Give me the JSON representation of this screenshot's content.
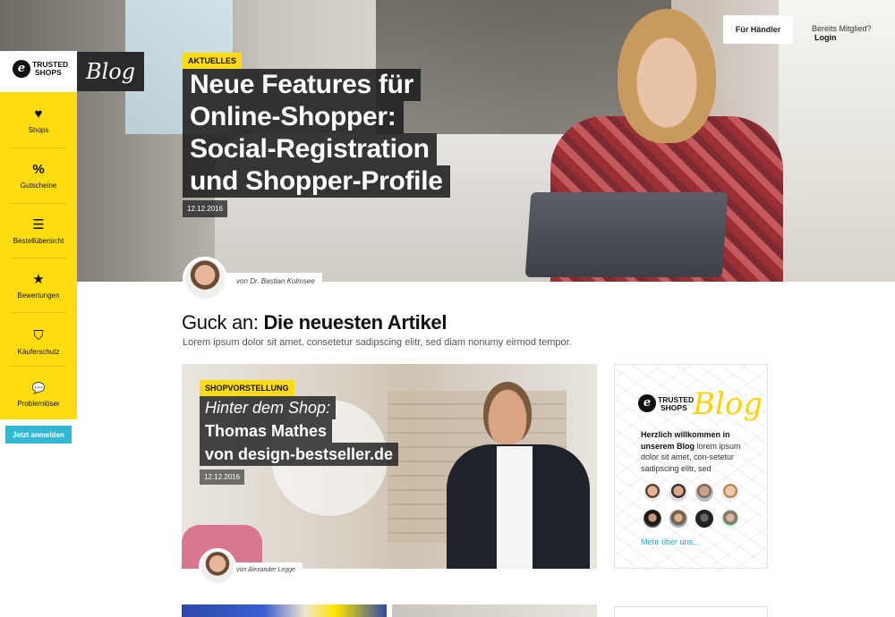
{
  "header": {
    "haendler_label": "Für Händler",
    "member_label": "Bereits Mitglied?",
    "login_label": "Login"
  },
  "brand": {
    "logo_letter": "e",
    "logo_line1": "TRUSTED",
    "logo_line2": "SHOPS",
    "blog_label": "Blog",
    "accent_color": "#ffdc0f",
    "link_color": "#33b8d4"
  },
  "sidebar": {
    "items": [
      {
        "label": "Shops",
        "icon": "heart-icon",
        "glyph": "♥"
      },
      {
        "label": "Gutscheine",
        "icon": "percent-icon",
        "glyph": "%"
      },
      {
        "label": "Bestellübersicht",
        "icon": "list-icon",
        "glyph": "☰"
      },
      {
        "label": "Bewertungen",
        "icon": "star-icon",
        "glyph": "★"
      },
      {
        "label": "Käuferschutz",
        "icon": "shield-check-icon",
        "glyph": "⛉"
      },
      {
        "label": "Problemlöser",
        "icon": "chat-icon",
        "glyph": "💬"
      }
    ],
    "signup_label": "Jetzt anmelden"
  },
  "hero": {
    "tag": "AKTUELLES",
    "title_lines": [
      "Neue Features für",
      "Online-Shopper:",
      "Social-Registration",
      "und Shopper-Profile"
    ],
    "date": "12.12.2016",
    "author": "von Dr. Bastian Kolmsee"
  },
  "section": {
    "title_prefix": "Guck an:",
    "title_strong": "Die neuesten Artikel",
    "subtitle": "Lorem ipsum dolor sit amet, consetetur sadipscing elitr, sed diam nonumy eirmod tempor."
  },
  "article": {
    "tag": "SHOPVORSTELLUNG",
    "title_lines": [
      "Hinter dem Shop:",
      "Thomas Mathes",
      "von design-bestseller.de"
    ],
    "date": "12.12.2016",
    "author": "von Alexander Legge"
  },
  "widget": {
    "logo_letter": "e",
    "logo_line1": "TRUSTED",
    "logo_line2": "SHOPS",
    "blog_label": "Blog",
    "intro_bold": "Herzlich willkommen in unserem Blog",
    "intro_text": " lorem ipsum dolor sit amet, con-setetur sadipscing elitr, sed",
    "more_link": "Mehr über uns..."
  }
}
